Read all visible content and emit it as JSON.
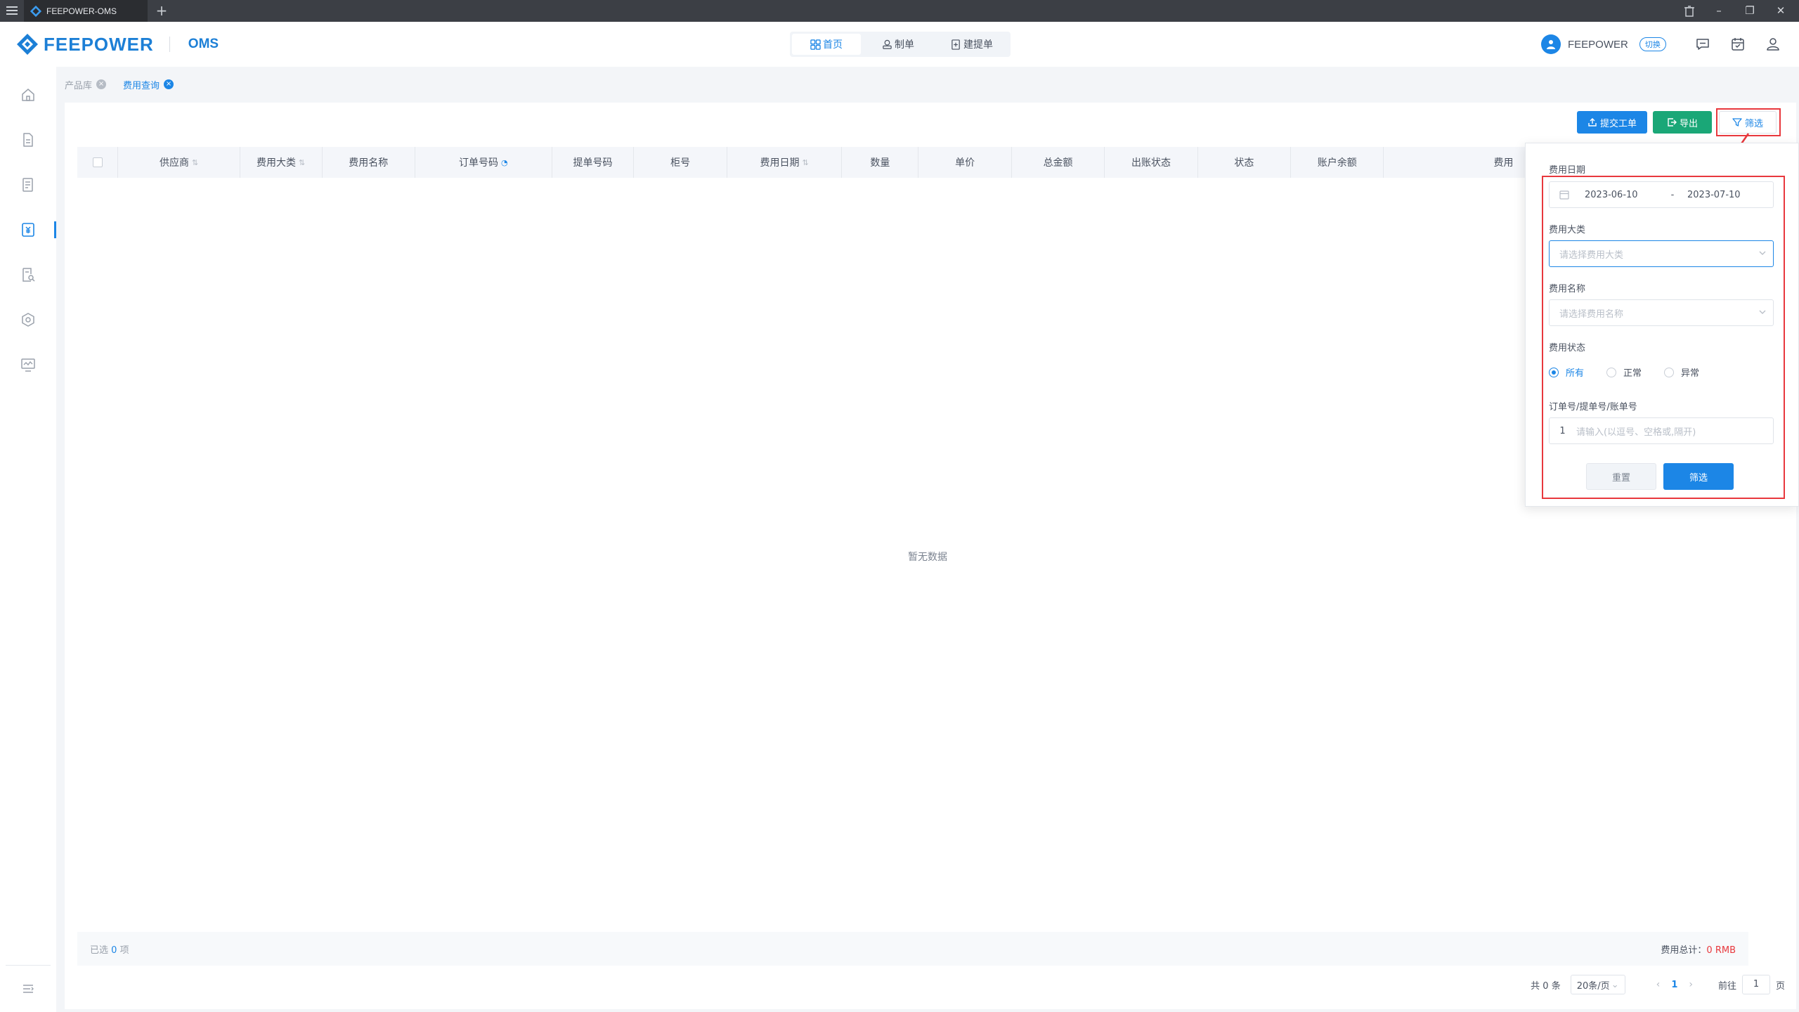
{
  "window": {
    "tab_title": "FEEPOWER-OMS",
    "new_tab": "+",
    "minimize": "–",
    "restore": "❐",
    "close": "✕"
  },
  "header": {
    "logo_text": "FEEPOWER",
    "logo_sub": "OMS",
    "nav": [
      {
        "label": "首页",
        "icon": "grid-icon",
        "active": true
      },
      {
        "label": "制单",
        "icon": "stamp-icon",
        "active": false
      },
      {
        "label": "建提单",
        "icon": "doc-plus-icon",
        "active": false
      }
    ],
    "user_name": "FEEPOWER",
    "switch_label": "切换",
    "icons": [
      "chat-icon",
      "calendar-icon",
      "user-icon"
    ]
  },
  "sidebar": {
    "items": [
      "home-icon",
      "document-icon",
      "list-icon",
      "fee-icon",
      "search-doc-icon",
      "settings-icon",
      "monitor-icon"
    ],
    "active_index": 3,
    "collapse_icon": "collapse-menu-icon"
  },
  "tags": [
    {
      "label": "产品库",
      "active": false
    },
    {
      "label": "费用查询",
      "active": true
    }
  ],
  "toolbar": {
    "submit_ticket": "提交工单",
    "export": "导出",
    "filter": "筛选"
  },
  "table": {
    "columns": [
      {
        "label": "",
        "checkbox": true
      },
      {
        "label": "供应商",
        "sortable": true
      },
      {
        "label": "费用大类",
        "sortable": true
      },
      {
        "label": "费用名称",
        "sortable": false
      },
      {
        "label": "订单号码",
        "sortable": false,
        "info": true
      },
      {
        "label": "提单号码",
        "sortable": false
      },
      {
        "label": "柜号",
        "sortable": false
      },
      {
        "label": "费用日期",
        "sortable": true
      },
      {
        "label": "数量",
        "sortable": false
      },
      {
        "label": "单价",
        "sortable": false
      },
      {
        "label": "总金额",
        "sortable": false
      },
      {
        "label": "出账状态",
        "sortable": false
      },
      {
        "label": "状态",
        "sortable": false
      },
      {
        "label": "账户余额",
        "sortable": false
      },
      {
        "label": "费用",
        "sortable": false
      }
    ],
    "empty_text": "暂无数据"
  },
  "summary": {
    "selected_prefix": "已选",
    "selected_count": "0",
    "selected_suffix": "项",
    "total_label": "费用总计：",
    "total_value": "0 RMB"
  },
  "pager": {
    "total_text": "共 0 条",
    "page_size": "20条/页",
    "prev": "‹",
    "current_page": "1",
    "next": "›",
    "goto_label": "前往",
    "goto_value": "1",
    "page_unit": "页"
  },
  "filter": {
    "date_label": "费用日期",
    "date_start": "2023-06-10",
    "date_sep": "-",
    "date_end": "2023-07-10",
    "category_label": "费用大类",
    "category_placeholder": "请选择费用大类",
    "name_label": "费用名称",
    "name_placeholder": "请选择费用名称",
    "status_label": "费用状态",
    "status_options": [
      {
        "label": "所有",
        "selected": true
      },
      {
        "label": "正常",
        "selected": false
      },
      {
        "label": "异常",
        "selected": false
      }
    ],
    "number_label": "订单号/提单号/账单号",
    "number_prefix": "1",
    "number_placeholder": "请输入(以逗号、空格或,隔开)",
    "reset": "重置",
    "submit": "筛选"
  },
  "colors": {
    "primary": "#1c86e6",
    "success": "#1aa777",
    "danger": "#e8383d",
    "brand": "#1c7fd6"
  }
}
